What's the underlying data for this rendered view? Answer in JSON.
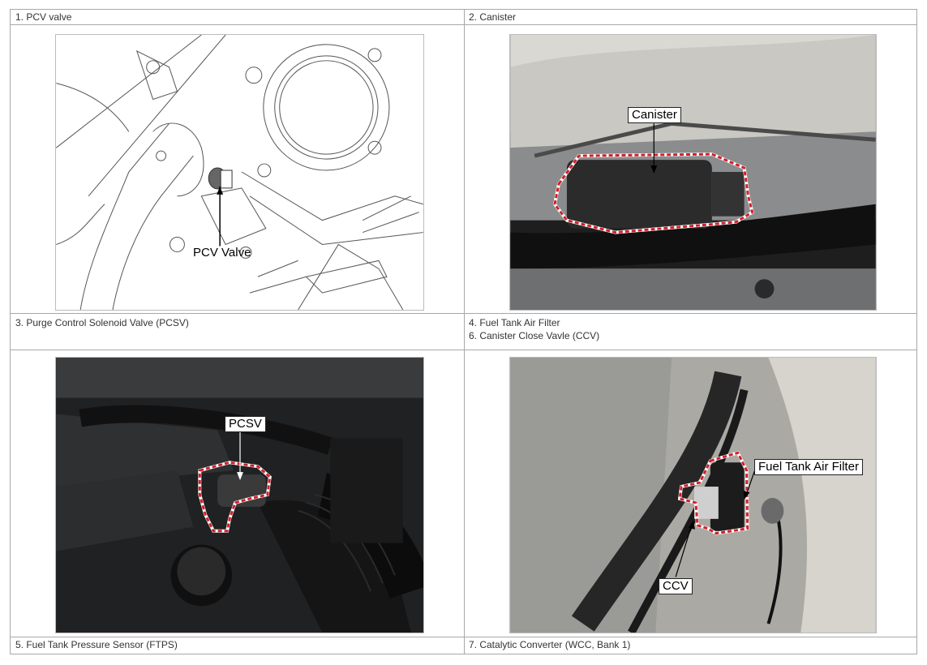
{
  "captions": {
    "c1": "1. PCV valve",
    "c2": "2. Canister",
    "c3": "3. Purge Control Solenoid Valve (PCSV)",
    "c4a": "4. Fuel Tank Air Filter",
    "c4b": "6. Canister Close Vavle (CCV)",
    "c5": "5. Fuel Tank Pressure Sensor (FTPS)",
    "c7": "7. Catalytic Converter (WCC, Bank 1)"
  },
  "callouts": {
    "pcv_valve": "PCV Valve",
    "canister": "Canister",
    "pcsv": "PCSV",
    "fuel_tank_air_filter": "Fuel Tank Air Filter",
    "ccv": "CCV"
  },
  "colors": {
    "border": "#a8a8a8",
    "highlight_dash": "#d0202a"
  }
}
